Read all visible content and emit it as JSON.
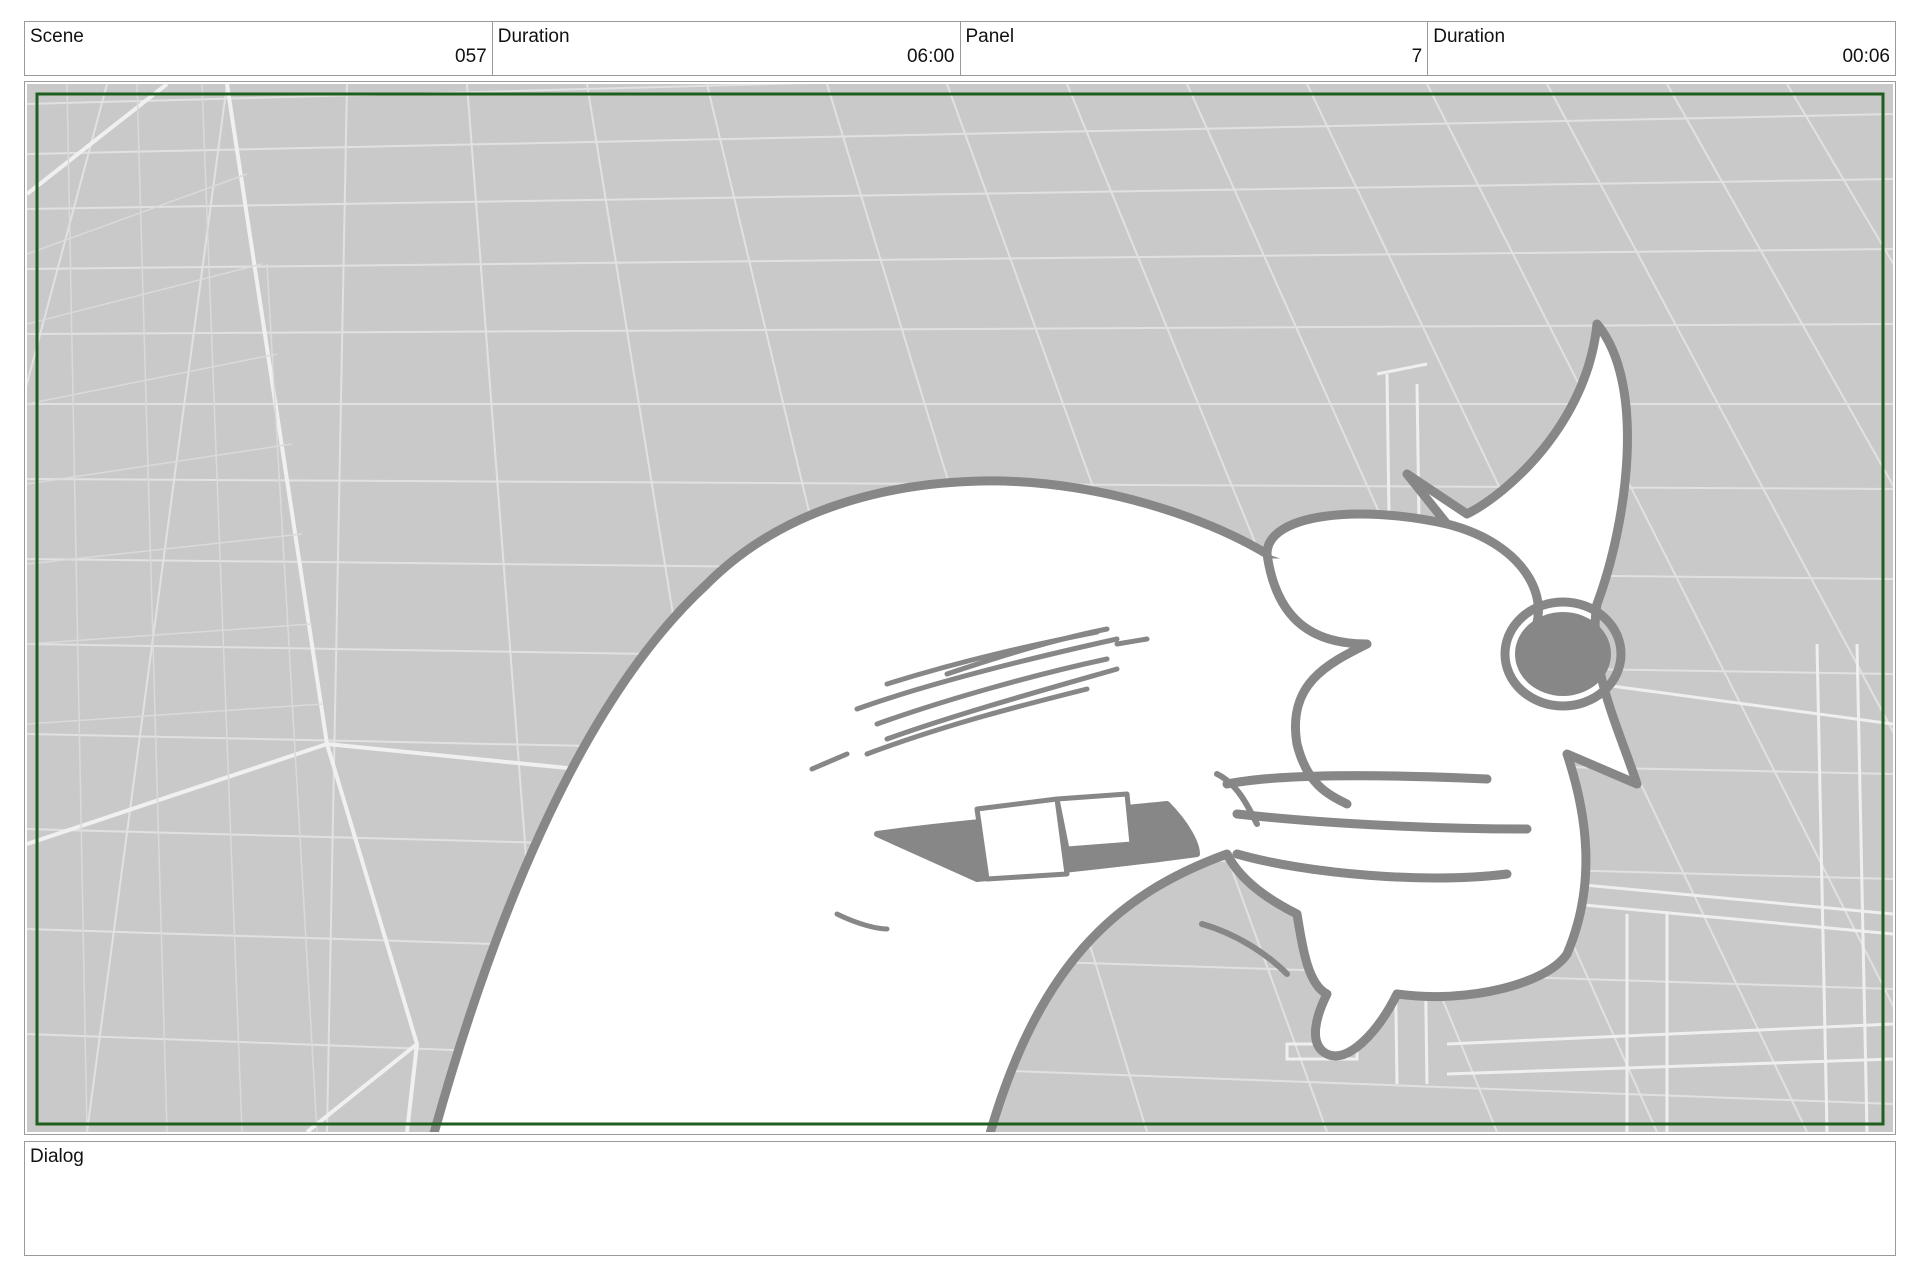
{
  "header": {
    "scene": {
      "label": "Scene",
      "value": "057"
    },
    "scene_duration": {
      "label": "Duration",
      "value": "06:00"
    },
    "panel": {
      "label": "Panel",
      "value": "7"
    },
    "panel_duration": {
      "label": "Duration",
      "value": "00:06"
    }
  },
  "panel_image": {
    "description_icon": "storyboard-drawing",
    "background_color": "#c9c9c9",
    "grid_line_color": "#e6e6e6",
    "ink_color": "#8a8a8a",
    "safe_frame_color": "#1f5e1f"
  },
  "dialog": {
    "label": "Dialog",
    "text": ""
  }
}
